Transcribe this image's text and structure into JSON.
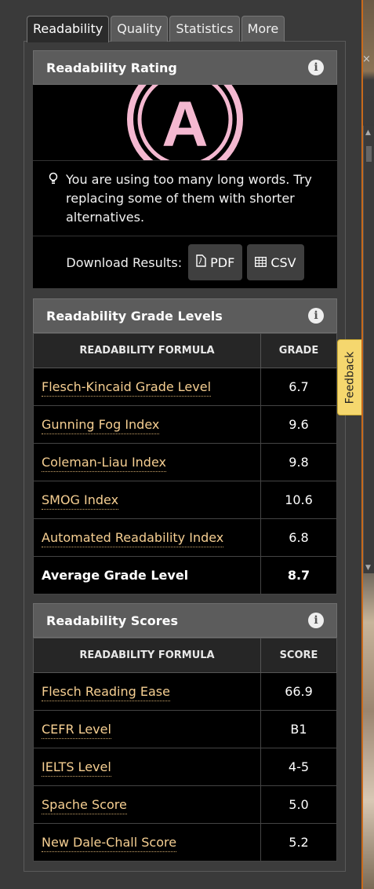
{
  "tabs": [
    "Readability",
    "Quality",
    "Statistics",
    "More"
  ],
  "rating": {
    "title": "Readability Rating",
    "grade": "A",
    "tip": "You are using too many long words. Try replacing some of them with shorter alternatives.",
    "download_label": "Download Results:",
    "pdf_label": "PDF",
    "csv_label": "CSV"
  },
  "grade_levels": {
    "title": "Readability Grade Levels",
    "col_formula": "READABILITY FORMULA",
    "col_value": "GRADE",
    "rows": [
      {
        "name": "Flesch-Kincaid Grade Level",
        "value": "6.7"
      },
      {
        "name": "Gunning Fog Index",
        "value": "9.6"
      },
      {
        "name": "Coleman-Liau Index",
        "value": "9.8"
      },
      {
        "name": "SMOG Index",
        "value": "10.6"
      },
      {
        "name": "Automated Readability Index",
        "value": "6.8"
      }
    ],
    "average_label": "Average Grade Level",
    "average_value": "8.7"
  },
  "scores": {
    "title": "Readability Scores",
    "col_formula": "READABILITY FORMULA",
    "col_value": "SCORE",
    "rows": [
      {
        "name": "Flesch Reading Ease",
        "value": "66.9"
      },
      {
        "name": "CEFR Level",
        "value": "B1"
      },
      {
        "name": "IELTS Level",
        "value": "4-5"
      },
      {
        "name": "Spache Score",
        "value": "5.0"
      },
      {
        "name": "New Dale-Chall Score",
        "value": "5.2"
      }
    ]
  },
  "feedback_label": "Feedback",
  "colors": {
    "link": "#f6cf92",
    "grade_ring": "#f4b8d0",
    "feedback_bg": "#f5d76e"
  },
  "icons": [
    "info-icon",
    "lightbulb-icon",
    "pdf-file-icon",
    "table-icon",
    "close-icon"
  ]
}
